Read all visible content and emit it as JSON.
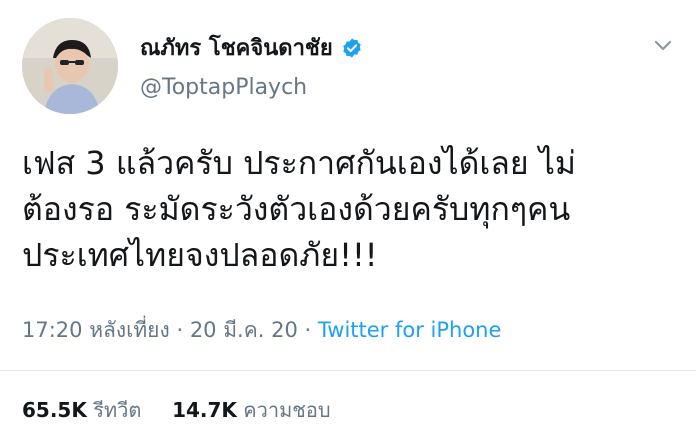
{
  "tweet": {
    "display_name": "ณภัทร โชคจินดาชัย",
    "handle": "@ToptapPlaych",
    "verified_icon": "verified-badge-icon",
    "more_icon": "chevron-down-icon",
    "text_lines": [
      "เฟส 3 แล้วครับ ประกาศกันเองได้เลย ไม่",
      "ต้องรอ ระมัดระวังตัวเองด้วยครับทุกๆคน",
      "ประเทศไทยจงปลอดภัย!!!"
    ],
    "time": "17:20 หลังเที่ยง",
    "separator": "·",
    "date": "20 มี.ค. 20",
    "source": "Twitter for iPhone",
    "stats": {
      "retweets": "65.5K",
      "retweets_label": "รีทวีต",
      "likes": "14.7K",
      "likes_label": "ความชอบ"
    }
  },
  "colors": {
    "accent": "#1da1f2",
    "secondary_text": "#657786",
    "primary_text": "#14171a"
  }
}
